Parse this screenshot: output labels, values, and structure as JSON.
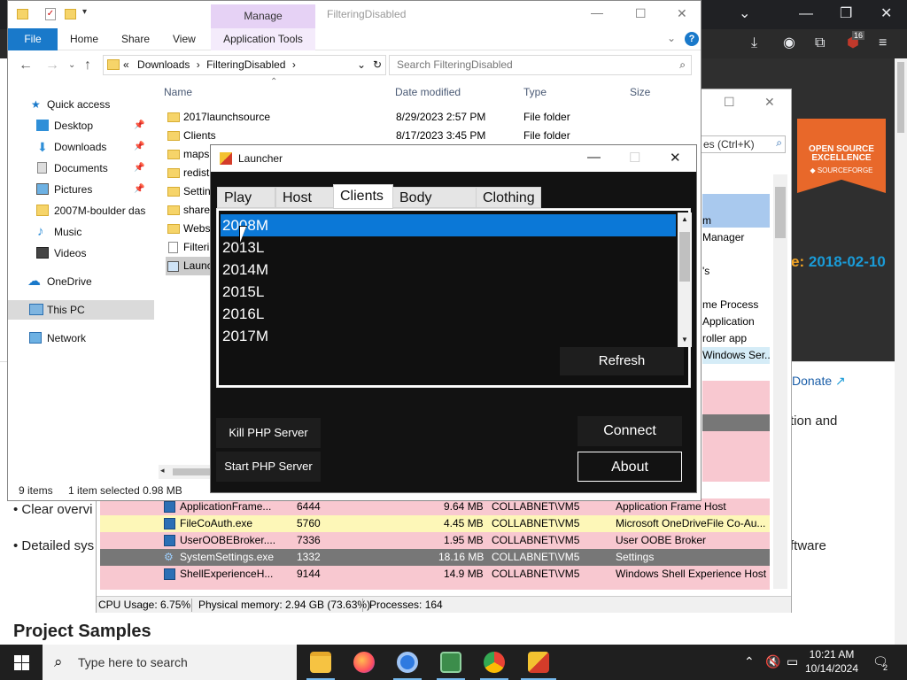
{
  "browser": {
    "toolbar_badge": "16",
    "page": {
      "date_label": "2018-02-10",
      "date_prefix": "e:",
      "donate": "Donate",
      "text_right_1": "tion and",
      "text_right_2": "ftware",
      "bullet_1": "• Clear overvi",
      "bullet_2": "• Detailed sys",
      "project_samples": "Project Samples",
      "ose_badge_line1": "OPEN SOURCE",
      "ose_badge_line2": "EXCELLENCE",
      "ose_badge_line3": "◆ SOURCEFORGE"
    }
  },
  "task_manager": {
    "search_placeholder": "es (Ctrl+K)",
    "partial_descriptions": [
      "m",
      "Manager",
      "'s",
      "me Process",
      "Application",
      "roller app",
      "Windows Ser..."
    ],
    "rows": [
      {
        "name": "ApplicationFrame...",
        "pid": "6444",
        "memory": "9.64 MB",
        "user": "COLLABNET\\VM5",
        "description": "Application Frame Host",
        "color": "pink"
      },
      {
        "name": "FileCoAuth.exe",
        "pid": "5760",
        "memory": "4.45 MB",
        "user": "COLLABNET\\VM5",
        "description": "Microsoft OneDriveFile Co-Au...",
        "color": "yellow"
      },
      {
        "name": "UserOOBEBroker....",
        "pid": "7336",
        "memory": "1.95 MB",
        "user": "COLLABNET\\VM5",
        "description": "User OOBE Broker",
        "color": "pink"
      },
      {
        "name": "SystemSettings.exe",
        "pid": "1332",
        "memory": "18.16 MB",
        "user": "COLLABNET\\VM5",
        "description": "Settings",
        "color": "gray"
      },
      {
        "name": "ShellExperienceH...",
        "pid": "9144",
        "memory": "14.9 MB",
        "user": "COLLABNET\\VM5",
        "description": "Windows Shell Experience Host",
        "color": "pink"
      }
    ],
    "status": {
      "cpu": "CPU Usage: 6.75%",
      "memory": "Physical memory: 2.94 GB (73.63%)",
      "processes": "Processes: 164"
    }
  },
  "explorer": {
    "manage_tab": "Manage",
    "window_title": "FilteringDisabled",
    "ribbon": {
      "file": "File",
      "home": "Home",
      "share": "Share",
      "view": "View",
      "app_tools": "Application Tools"
    },
    "address": {
      "prefix": "«",
      "crumb_1": "Downloads",
      "crumb_2": "FilteringDisabled"
    },
    "search_placeholder": "Search FilteringDisabled",
    "nav": [
      {
        "label": "Quick access",
        "icon": "star-icon"
      },
      {
        "label": "Desktop",
        "icon": "desktop-icon",
        "pinned": true
      },
      {
        "label": "Downloads",
        "icon": "download-icon",
        "pinned": true
      },
      {
        "label": "Documents",
        "icon": "documents-icon",
        "pinned": true
      },
      {
        "label": "Pictures",
        "icon": "pictures-icon",
        "pinned": true
      },
      {
        "label": "2007M-boulder das",
        "icon": "folder-icon"
      },
      {
        "label": "Music",
        "icon": "music-icon"
      },
      {
        "label": "Videos",
        "icon": "videos-icon"
      },
      {
        "label": "OneDrive",
        "icon": "cloud-icon"
      },
      {
        "label": "This PC",
        "icon": "computer-icon"
      },
      {
        "label": "Network",
        "icon": "network-icon"
      }
    ],
    "columns": {
      "name": "Name",
      "date": "Date modified",
      "type": "Type",
      "size": "Size"
    },
    "files": [
      {
        "name": "2017launchsource",
        "date": "8/29/2023 2:57 PM",
        "type": "File folder"
      },
      {
        "name": "Clients",
        "date": "8/17/2023 3:45 PM",
        "type": "File folder"
      },
      {
        "name": "maps",
        "date": "",
        "type": ""
      },
      {
        "name": "redist",
        "date": "",
        "type": ""
      },
      {
        "name": "Setting",
        "date": "",
        "type": ""
      },
      {
        "name": "shared",
        "date": "",
        "type": ""
      },
      {
        "name": "Webs",
        "date": "",
        "type": ""
      },
      {
        "name": "Filterin",
        "date": "",
        "type": ""
      },
      {
        "name": "Launc",
        "date": "",
        "type": ""
      }
    ],
    "status": {
      "items": "9 items",
      "selected": "1 item selected  0.98 MB"
    }
  },
  "launcher": {
    "title": "Launcher",
    "tabs": [
      "Play",
      "Host",
      "Clients",
      "Body Colors",
      "Clothing"
    ],
    "active_tab": "Clients",
    "clients": [
      "2008M",
      "2013L",
      "2014M",
      "2015L",
      "2016L",
      "2017M"
    ],
    "selected_client": "2008M",
    "buttons": {
      "refresh": "Refresh",
      "kill_php": "Kill PHP Server",
      "start_php": "Start PHP Server",
      "connect": "Connect",
      "about": "About"
    }
  },
  "taskbar": {
    "search_placeholder": "Type here to search",
    "time": "10:21 AM",
    "date": "10/14/2024",
    "notification_count": "2"
  },
  "colors": {
    "accent_blue": "#0b78d7",
    "ribbon_file": "#1979ca",
    "manage_tab": "#e6d2f5",
    "launcher_bg": "#121212",
    "taskbar": "#1f1f1f"
  }
}
